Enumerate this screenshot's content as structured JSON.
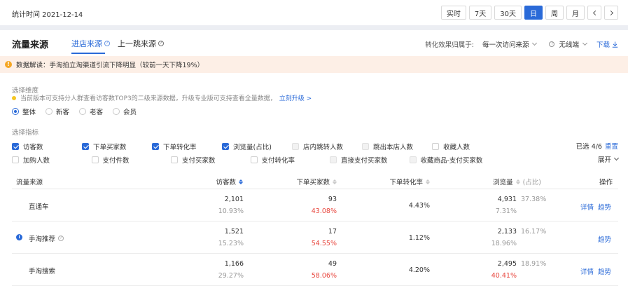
{
  "topbar": {
    "stat_label": "统计时间 2021-12-14",
    "time_buttons": [
      "实时",
      "7天",
      "30天",
      "日",
      "周",
      "月"
    ],
    "active_time": "日",
    "prev_icon": "chevron-left-icon",
    "next_icon": "chevron-right-icon"
  },
  "header": {
    "title": "流量来源",
    "tabs": [
      {
        "label": "进店来源",
        "active": true
      },
      {
        "label": "上一跳来源",
        "active": false
      }
    ],
    "attribution_label": "转化效果归属于:",
    "attribution_value": "每一次访问来源",
    "terminal_value": "无线端",
    "download_label": "下载"
  },
  "notice": {
    "text": "数据解读：手淘拍立淘渠道引流下降明显（较前一天下降19%）",
    "icon": "warning-icon"
  },
  "dimension": {
    "label": "选择维度",
    "hint": "当前版本可支持分人群查看访客数TOP3的二级来源数据，升级专业版可支持查看全量数据，",
    "hint_link": "立刻升级 >",
    "options": [
      "整体",
      "新客",
      "老客",
      "会员"
    ],
    "selected": "整体"
  },
  "metrics": {
    "label": "选择指标",
    "rows": [
      [
        {
          "label": "访客数",
          "state": "checked"
        },
        {
          "label": "下单买家数",
          "state": "checked"
        },
        {
          "label": "下单转化率",
          "state": "checked"
        },
        {
          "label": "浏览量(占比)",
          "state": "checked"
        },
        {
          "label": "店内跳转人数",
          "state": "disabled"
        },
        {
          "label": "跳出本店人数",
          "state": "disabled"
        },
        {
          "label": "收藏人数",
          "state": "unchecked"
        }
      ],
      [
        {
          "label": "加购人数",
          "state": "unchecked"
        },
        {
          "label": "支付件数",
          "state": "unchecked"
        },
        {
          "label": "支付买家数",
          "state": "unchecked"
        },
        {
          "label": "支付转化率",
          "state": "unchecked"
        },
        {
          "label": "直接支付买家数",
          "state": "disabled"
        },
        {
          "label": "收藏商品-支付买家数",
          "state": "disabled"
        }
      ]
    ],
    "selected_count": "已选 4/6",
    "reset_label": "重置",
    "expand_label": "展开"
  },
  "table": {
    "columns": {
      "source": "流量来源",
      "visitors": "访客数",
      "buyers": "下单买家数",
      "conv": "下单转化率",
      "pv": "浏览量",
      "pv_suffix": "(占比)",
      "ops": "操作"
    },
    "rows": [
      {
        "source": "直通车",
        "has_dot": false,
        "has_info": false,
        "visitors": "2,101",
        "visitors_pct": "10.93%",
        "buyers": "93",
        "buyers_pct": "43.08%",
        "conv": "4.43%",
        "pv": "4,931",
        "pv_share": "37.38%",
        "pv_pct": "7.31%",
        "ops": [
          "详情",
          "趋势"
        ]
      },
      {
        "source": "手淘推荐",
        "has_dot": true,
        "has_info": true,
        "visitors": "1,521",
        "visitors_pct": "15.23%",
        "buyers": "17",
        "buyers_pct": "54.55%",
        "conv": "1.12%",
        "pv": "2,133",
        "pv_share": "16.17%",
        "pv_pct": "18.96%",
        "ops": [
          "趋势"
        ]
      },
      {
        "source": "手淘搜索",
        "has_dot": false,
        "has_info": false,
        "visitors": "1,166",
        "visitors_pct": "29.27%",
        "buyers": "49",
        "buyers_pct": "58.06%",
        "conv": "4.20%",
        "pv": "2,495",
        "pv_share": "18.91%",
        "pv_pct": "40.41%",
        "ops": [
          "详情",
          "趋势"
        ]
      }
    ]
  },
  "colors": {
    "accent": "#2a6ad8",
    "negative": "#e8453c",
    "notice_bg": "#fdefe6",
    "warning": "#f5a623"
  }
}
